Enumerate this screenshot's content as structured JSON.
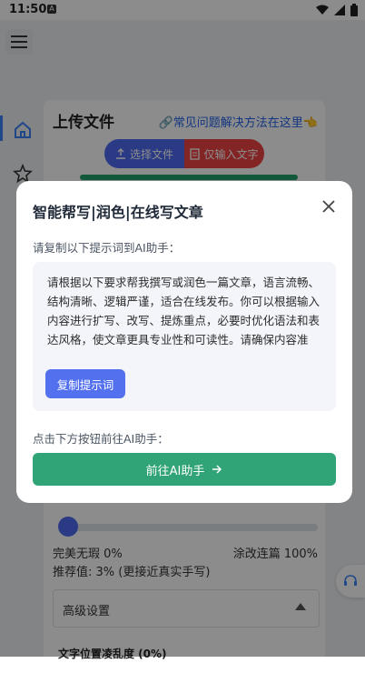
{
  "status_bar": {
    "time": "11:50",
    "notification_icon": "A"
  },
  "sidebar": {
    "icons": [
      "home-icon",
      "star-icon"
    ]
  },
  "main": {
    "title": "上传文件",
    "faq_link": "常见问题解决方法在这里",
    "select_file_label": "选择文件",
    "text_only_label": "仅输入文字"
  },
  "slider": {
    "min_label": "完美无瑕 0%",
    "max_label": "涂改连篇 100%",
    "value": 0.03,
    "recommend": "推荐值: 3% (更接近真实手写)"
  },
  "advanced": {
    "label": "高级设置"
  },
  "next_setting": {
    "label": "文字位置凌乱度 (0%)"
  },
  "modal": {
    "title": "智能帮写|润色|在线写文章",
    "subtitle": "请复制以下提示词到AI助手：",
    "prompt": "请根据以下要求帮我撰写或润色一篇文章，语言流畅、结构清晰、逻辑严谨，适合在线发布。你可以根据输入内容进行扩写、改写、提炼重点，必要时优化语法和表达风格，使文章更具专业性和可读性。请确保内容准确、表达自然，并根据语境使用恰当的词汇",
    "copy_button": "复制提示词",
    "footer_label": "点击下方按钮前往AI助手：",
    "go_button": "前往AI助手"
  },
  "colors": {
    "primary": "#5370ef",
    "danger": "#ef4444",
    "success": "#31a477",
    "link": "#2563eb"
  }
}
